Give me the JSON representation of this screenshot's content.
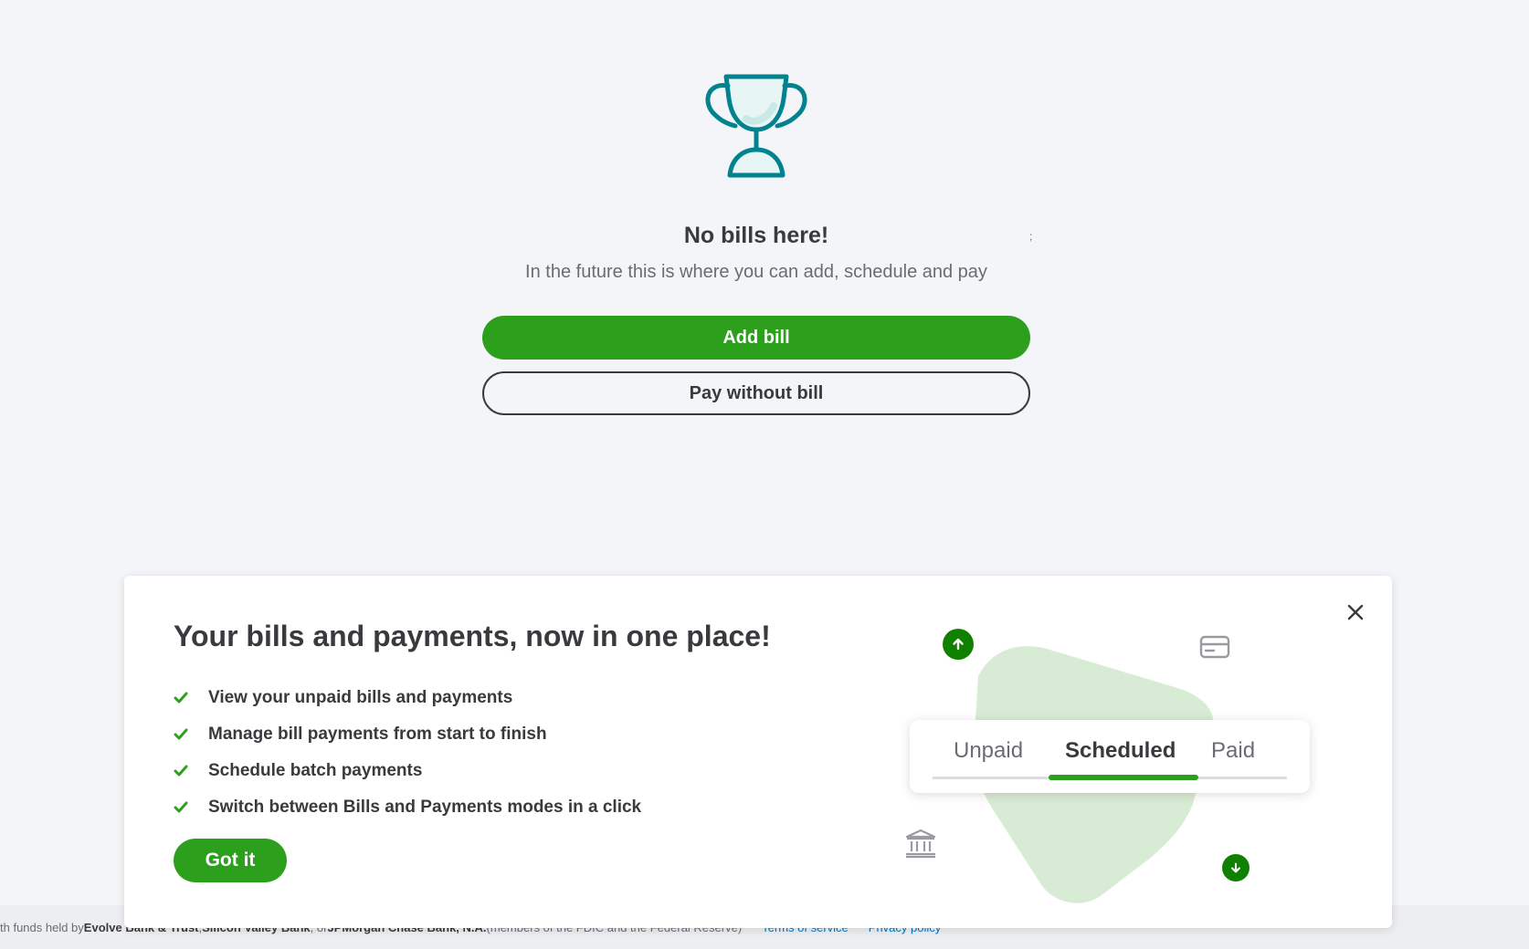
{
  "empty_state": {
    "title": "No bills here!",
    "subtitle": "In the future this is where you can add, schedule and pay",
    "primary_button": "Add bill",
    "secondary_button": "Pay without bill",
    "icon": "trophy-icon"
  },
  "stray_mark": ";",
  "onboarding": {
    "title": "Your bills and payments, now in one place!",
    "features": [
      "View your unpaid bills and payments",
      "Manage bill payments from start to finish",
      "Schedule batch payments",
      "Switch between Bills and Payments modes in a click"
    ],
    "got_it_button": "Got it",
    "illustration_tabs": [
      "Unpaid",
      "Scheduled",
      "Paid"
    ],
    "active_tab": "Scheduled"
  },
  "footer": {
    "prefix": "th funds held by ",
    "bank1": "Evolve Bank & Trust",
    "sep1": ", ",
    "bank2": "Silicon Valley Bank",
    "sep2": ", or ",
    "bank3": "JPMorgan Chase Bank, N.A.",
    "suffix": " (members of the FDIC and the Federal Reserve)",
    "terms_link": "Terms of service",
    "privacy_link": "Privacy policy"
  },
  "colors": {
    "brand_green": "#2ca01c",
    "dark_green": "#108000",
    "teal": "#00838f",
    "text_primary": "#393a3d",
    "link": "#0077c5",
    "background": "#f3f5f8"
  }
}
